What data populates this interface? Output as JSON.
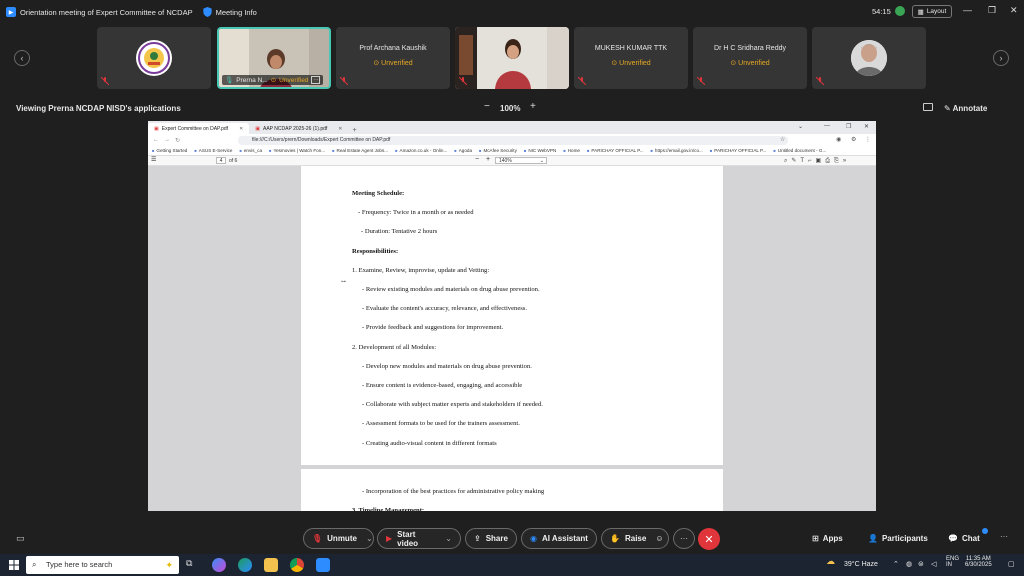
{
  "titlebar": {
    "title": "Orientation meeting of Expert Committee of NCDAP",
    "meeting_info": "Meeting Info",
    "timer": "54:15",
    "layout_label": "Layout"
  },
  "participants": [
    {
      "name": "",
      "status": "",
      "avatar": "logo"
    },
    {
      "name": "Prerna N...",
      "status": "Unverified",
      "avatar": "video-woman"
    },
    {
      "name": "Prof Archana Kaushik",
      "status": "Unverified"
    },
    {
      "name": "",
      "status": "",
      "avatar": "video-woman-room"
    },
    {
      "name": "MUKESH KUMAR TTK",
      "status": "Unverified"
    },
    {
      "name": "Dr H C Sridhara Reddy",
      "status": "Unverified"
    },
    {
      "name": "",
      "status": "",
      "avatar": "photo-man"
    }
  ],
  "share": {
    "viewing": "Viewing Prerna NCDAP NISD's applications",
    "zoom": "100%",
    "annotate": "Annotate"
  },
  "browser": {
    "tabs": [
      {
        "title": "Expert Committee on DAP.pdf",
        "active": true
      },
      {
        "title": "AAP NCDAP 2025-26 (1).pdf",
        "active": false
      }
    ],
    "url": "file:///C:/Users/prern/Downloads/Expert Committee on DAP.pdf",
    "bookmarks": [
      "Getting Started",
      "ASUS E-Service",
      "envis_ca",
      "Yesmovies | Watch Fon...",
      "Real Estate Agent Jobs...",
      "Amazon.co.uk - Onlin...",
      "Agoda",
      "McAfee Security",
      "NIC WebVPN",
      "Home",
      "PARICHAY OFFICIAL P...",
      "https://email.gov.in/co...",
      "PARICHAY OFFICIAL P...",
      "Untitled document - G..."
    ],
    "pdf_page": "4",
    "pdf_of": "of 6",
    "pdf_zoom": "140%"
  },
  "document": {
    "page1": [
      {
        "text": "Meeting Schedule:",
        "bold": true,
        "indent": 0
      },
      {
        "text": "- Frequency: Twice in a month or as needed",
        "bold": false,
        "indent": 1
      },
      {
        "text": "- Duration: Tentative 2 hours",
        "bold": false,
        "indent": 1
      },
      {
        "text": "Responsibilities:",
        "bold": true,
        "indent": 0
      },
      {
        "text": "1. Examine, Review, improvise, update and Vetting:",
        "bold": false,
        "indent": 0
      },
      {
        "text": "- Review existing modules and materials on drug abuse prevention.",
        "bold": false,
        "indent": 2
      },
      {
        "text": "- Evaluate the content's accuracy, relevance, and effectiveness.",
        "bold": false,
        "indent": 2
      },
      {
        "text": "- Provide feedback and suggestions for improvement.",
        "bold": false,
        "indent": 2
      },
      {
        "text": "2. Development of all Modules:",
        "bold": false,
        "indent": 0
      },
      {
        "text": "- Develop new modules and materials on drug abuse prevention.",
        "bold": false,
        "indent": 2
      },
      {
        "text": "- Ensure content is evidence-based, engaging, and accessible",
        "bold": false,
        "indent": 2
      },
      {
        "text": "- Collaborate with subject matter experts and stakeholders if needed.",
        "bold": false,
        "indent": 2
      },
      {
        "text": "- Assessment formats to be used for the trainers assessment.",
        "bold": false,
        "indent": 2
      },
      {
        "text": "- Creating audio-visual content in different formats",
        "bold": false,
        "indent": 2
      }
    ],
    "page2": [
      {
        "text": "- Incorporation of the best practices for administrative policy making",
        "bold": false,
        "indent": 2
      },
      {
        "text": "3. Timeline Management:",
        "bold": true,
        "indent": 0
      }
    ]
  },
  "toolbar": {
    "unmute": "Unmute",
    "start_video": "Start video",
    "share": "Share",
    "ai_assistant": "AI Assistant",
    "raise": "Raise",
    "apps": "Apps",
    "participants": "Participants",
    "chat": "Chat"
  },
  "taskbar": {
    "search_placeholder": "Type here to search",
    "weather": "39°C  Haze",
    "lang_line1": "ENG",
    "lang_line2": "IN",
    "time": "11:35 AM",
    "date": "6/30/2025"
  },
  "colors": {
    "accent": "#2d8cff",
    "active_tile_border": "#48c7b4",
    "unverified": "#e5a823",
    "leave": "#e0353a"
  }
}
